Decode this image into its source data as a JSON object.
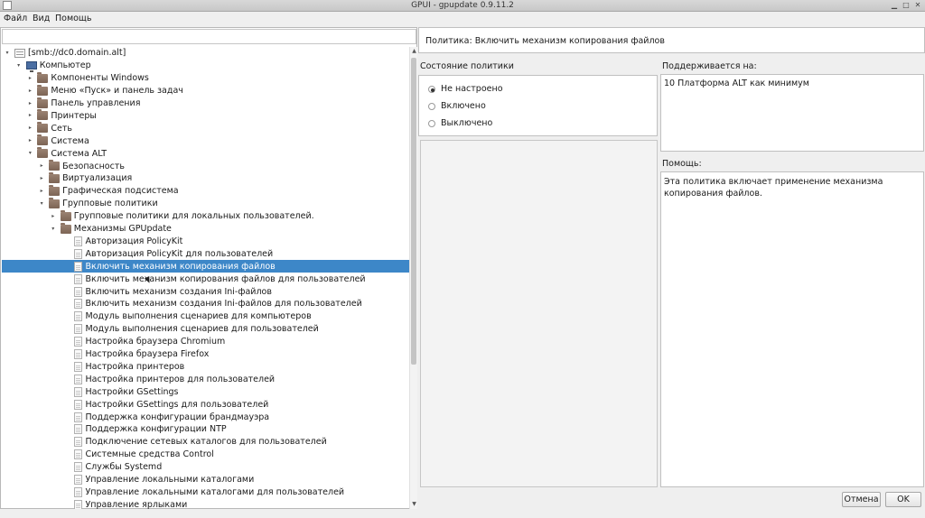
{
  "window": {
    "title": "GPUI - gpupdate 0.9.11.2"
  },
  "menu": [
    "Файл",
    "Вид",
    "Помощь"
  ],
  "search": {
    "placeholder": ""
  },
  "tree": [
    {
      "label": "[smb://dc0.domain.alt]",
      "level": 0,
      "expander": "▾",
      "icon": "server-icon"
    },
    {
      "label": "Компьютер",
      "level": 1,
      "expander": "▾",
      "icon": "computer-icon"
    },
    {
      "label": "Компоненты Windows",
      "level": 2,
      "expander": "▸",
      "icon": "folder-icon"
    },
    {
      "label": "Меню «Пуск» и панель задач",
      "level": 2,
      "expander": "▸",
      "icon": "folder-icon"
    },
    {
      "label": "Панель управления",
      "level": 2,
      "expander": "▸",
      "icon": "folder-icon"
    },
    {
      "label": "Принтеры",
      "level": 2,
      "expander": "▸",
      "icon": "folder-icon"
    },
    {
      "label": "Сеть",
      "level": 2,
      "expander": "▸",
      "icon": "folder-icon"
    },
    {
      "label": "Система",
      "level": 2,
      "expander": "▸",
      "icon": "folder-icon"
    },
    {
      "label": "Система ALT",
      "level": 2,
      "expander": "▾",
      "icon": "folder-icon"
    },
    {
      "label": "Безопасность",
      "level": 3,
      "expander": "▸",
      "icon": "folder-icon"
    },
    {
      "label": "Виртуализация",
      "level": 3,
      "expander": "▸",
      "icon": "folder-icon"
    },
    {
      "label": "Графическая подсистема",
      "level": 3,
      "expander": "▸",
      "icon": "folder-icon"
    },
    {
      "label": "Групповые политики",
      "level": 3,
      "expander": "▾",
      "icon": "folder-icon"
    },
    {
      "label": "Групповые политики для локальных пользователей.",
      "level": 4,
      "expander": "▸",
      "icon": "folder-icon"
    },
    {
      "label": "Механизмы GPUpdate",
      "level": 4,
      "expander": "▾",
      "icon": "folder-icon"
    },
    {
      "label": "Авторизация PolicyKit",
      "level": 5,
      "expander": "",
      "icon": "doc-icon"
    },
    {
      "label": "Авторизация PolicyKit для пользователей",
      "level": 5,
      "expander": "",
      "icon": "doc-icon"
    },
    {
      "label": "Включить механизм копирования файлов",
      "level": 5,
      "expander": "",
      "icon": "doc-icon",
      "selected": true
    },
    {
      "label": "Включить механизм копирования файлов для пользователей",
      "level": 5,
      "expander": "",
      "icon": "doc-icon"
    },
    {
      "label": "Включить механизм создания Ini-файлов",
      "level": 5,
      "expander": "",
      "icon": "doc-icon"
    },
    {
      "label": "Включить механизм создания Ini-файлов для пользователей",
      "level": 5,
      "expander": "",
      "icon": "doc-icon"
    },
    {
      "label": "Модуль выполнения сценариев для компьютеров",
      "level": 5,
      "expander": "",
      "icon": "doc-icon"
    },
    {
      "label": "Модуль выполнения сценариев для пользователей",
      "level": 5,
      "expander": "",
      "icon": "doc-icon"
    },
    {
      "label": "Настройка браузера Chromium",
      "level": 5,
      "expander": "",
      "icon": "doc-icon"
    },
    {
      "label": "Настройка браузера Firefox",
      "level": 5,
      "expander": "",
      "icon": "doc-icon"
    },
    {
      "label": "Настройка принтеров",
      "level": 5,
      "expander": "",
      "icon": "doc-icon"
    },
    {
      "label": "Настройка принтеров для пользователей",
      "level": 5,
      "expander": "",
      "icon": "doc-icon"
    },
    {
      "label": "Настройки GSettings",
      "level": 5,
      "expander": "",
      "icon": "doc-icon"
    },
    {
      "label": "Настройки GSettings для пользователей",
      "level": 5,
      "expander": "",
      "icon": "doc-icon"
    },
    {
      "label": "Поддержка конфигурации брандмауэра",
      "level": 5,
      "expander": "",
      "icon": "doc-icon"
    },
    {
      "label": "Поддержка конфигурации NTP",
      "level": 5,
      "expander": "",
      "icon": "doc-icon"
    },
    {
      "label": "Подключение сетевых каталогов для пользователей",
      "level": 5,
      "expander": "",
      "icon": "doc-icon"
    },
    {
      "label": "Системные средства Control",
      "level": 5,
      "expander": "",
      "icon": "doc-icon"
    },
    {
      "label": "Службы Systemd",
      "level": 5,
      "expander": "",
      "icon": "doc-icon"
    },
    {
      "label": "Управление локальными каталогами",
      "level": 5,
      "expander": "",
      "icon": "doc-icon"
    },
    {
      "label": "Управление локальными каталогами для пользователей",
      "level": 5,
      "expander": "",
      "icon": "doc-icon"
    },
    {
      "label": "Управление ярлыками",
      "level": 5,
      "expander": "",
      "icon": "doc-icon"
    }
  ],
  "policy": {
    "header": "Политика: Включить механизм копирования файлов",
    "state_label": "Состояние политики",
    "options": [
      "Не настроено",
      "Включено",
      "Выключено"
    ],
    "selected_option": 0,
    "supported_label": "Поддерживается на:",
    "supported_value": "10 Платформа ALT как минимум",
    "help_label": "Помощь:",
    "help_text": "Эта политика включает применение механизма копирования файлов."
  },
  "buttons": {
    "cancel": "Отмена",
    "ok": "OK"
  }
}
